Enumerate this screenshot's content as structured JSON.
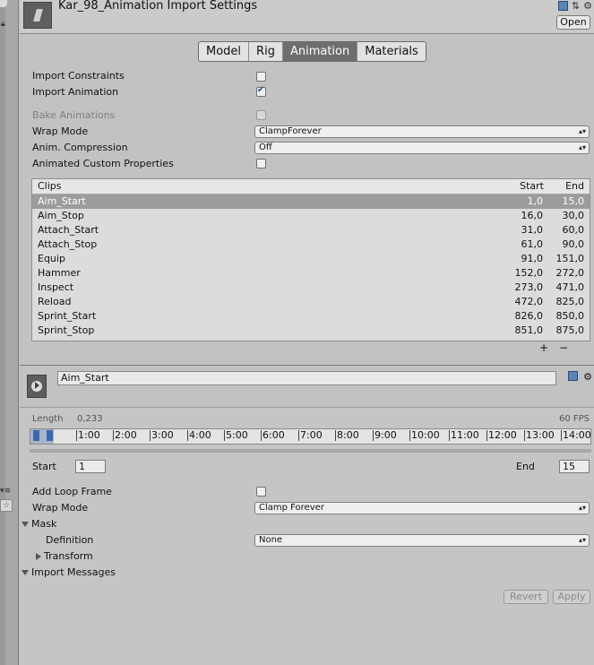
{
  "header": {
    "title": "Kar_98_Animation Import Settings",
    "open_label": "Open"
  },
  "tabs": [
    {
      "label": "Model"
    },
    {
      "label": "Rig"
    },
    {
      "label": "Animation"
    },
    {
      "label": "Materials"
    }
  ],
  "settings": {
    "import_constraints": {
      "label": "Import Constraints",
      "checked": false
    },
    "import_animation": {
      "label": "Import Animation",
      "checked": true
    },
    "bake_animations": {
      "label": "Bake Animations",
      "checked": false
    },
    "wrap_mode": {
      "label": "Wrap Mode",
      "value": "ClampForever"
    },
    "anim_compression": {
      "label": "Anim. Compression",
      "value": "Off"
    },
    "animated_custom_properties": {
      "label": "Animated Custom Properties",
      "checked": false
    }
  },
  "clips": {
    "header": {
      "name": "Clips",
      "start": "Start",
      "end": "End"
    },
    "rows": [
      {
        "name": "Aim_Start",
        "start": "1,0",
        "end": "15,0"
      },
      {
        "name": "Aim_Stop",
        "start": "16,0",
        "end": "30,0"
      },
      {
        "name": "Attach_Start",
        "start": "31,0",
        "end": "60,0"
      },
      {
        "name": "Attach_Stop",
        "start": "61,0",
        "end": "90,0"
      },
      {
        "name": "Equip",
        "start": "91,0",
        "end": "151,0"
      },
      {
        "name": "Hammer",
        "start": "152,0",
        "end": "272,0"
      },
      {
        "name": "Inspect",
        "start": "273,0",
        "end": "471,0"
      },
      {
        "name": "Reload",
        "start": "472,0",
        "end": "825,0"
      },
      {
        "name": "Sprint_Start",
        "start": "826,0",
        "end": "850,0"
      },
      {
        "name": "Sprint_Stop",
        "start": "851,0",
        "end": "875,0"
      }
    ],
    "add_label": "+",
    "remove_label": "−"
  },
  "clip_detail": {
    "name": "Aim_Start",
    "length_label": "Length",
    "length_value": "0,233",
    "fps": "60 FPS",
    "ticks": [
      "1:00",
      "2:00",
      "3:00",
      "4:00",
      "5:00",
      "6:00",
      "7:00",
      "8:00",
      "9:00",
      "10:00",
      "11:00",
      "12:00",
      "13:00",
      "14:00"
    ],
    "start_label": "Start",
    "start_value": "1",
    "end_label": "End",
    "end_value": "15",
    "add_loop_frame": {
      "label": "Add Loop Frame",
      "checked": false
    },
    "wrap_mode": {
      "label": "Wrap Mode",
      "value": "Clamp Forever"
    },
    "mask_label": "Mask",
    "definition": {
      "label": "Definition",
      "value": "None"
    },
    "transform_label": "Transform",
    "import_messages_label": "Import Messages"
  },
  "buttons": {
    "revert": "Revert",
    "apply": "Apply"
  }
}
